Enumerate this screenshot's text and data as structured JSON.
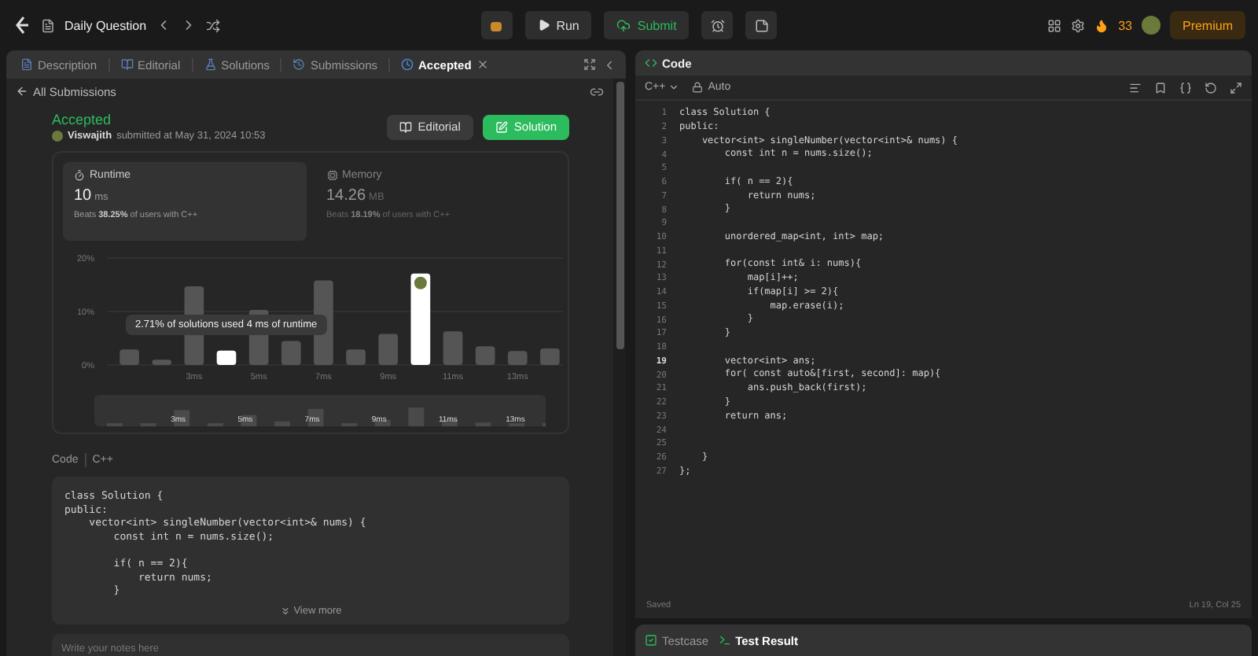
{
  "nav": {
    "title": "Daily Question",
    "run": "Run",
    "submit": "Submit",
    "streak": "33",
    "premium": "Premium"
  },
  "tabs": [
    {
      "label": "Description",
      "selected": false,
      "closable": false
    },
    {
      "label": "Editorial",
      "selected": false,
      "closable": false
    },
    {
      "label": "Solutions",
      "selected": false,
      "closable": false
    },
    {
      "label": "Submissions",
      "selected": false,
      "closable": false
    },
    {
      "label": "Accepted",
      "selected": true,
      "closable": true
    }
  ],
  "back_link": "All Submissions",
  "result": {
    "status": "Accepted",
    "user": "Viswajith",
    "submitted": "submitted at May 31, 2024 10:53",
    "editorial": "Editorial",
    "solution": "Solution"
  },
  "stats": [
    {
      "label": "Runtime",
      "value": "10",
      "unit": "ms",
      "beats": "Beats **38.25%** of users with C++",
      "selected": true
    },
    {
      "label": "Memory",
      "value": "14.26",
      "unit": "MB",
      "beats": "Beats **18.19%** of users with C++",
      "selected": false
    }
  ],
  "chart_data": {
    "type": "bar",
    "stacked": true,
    "categories": [
      null,
      null,
      "3ms",
      null,
      "5ms",
      null,
      "7ms",
      null,
      "9ms",
      null,
      "11ms",
      null,
      "13ms",
      null
    ],
    "series": [
      {
        "color": "#555555",
        "values": [
          2.9,
          1.0,
          14.7,
          null,
          10.3,
          4.5,
          15.8,
          2.9,
          5.8,
          null,
          6.3,
          3.5,
          2.6,
          3.1
        ]
      },
      {
        "color": "#ffffff",
        "values": [
          null,
          null,
          null,
          2.7,
          null,
          null,
          null,
          null,
          null,
          17.1,
          null,
          null,
          null,
          null
        ]
      }
    ],
    "ylim": [
      0,
      20
    ],
    "yticks": [
      {
        "value": 0,
        "label": "0%"
      },
      {
        "value": 10,
        "label": "10%"
      },
      {
        "value": 20,
        "label": "20%"
      }
    ],
    "annotations": [
      {
        "text": "2.71% of solutions used 4 ms of runtime"
      }
    ]
  },
  "overview_labels": [
    "3ms",
    "5ms",
    "7ms",
    "9ms",
    "11ms",
    "13ms"
  ],
  "code_label": "Code",
  "code_lang": "C++",
  "snippet": "class Solution {\npublic:\n    vector<int> singleNumber(vector<int>& nums) {\n        const int n = nums.size();\n\n        if( n == 2){\n            return nums;\n        }",
  "view_more": "View more",
  "notes": {
    "placeholder": "Write your notes here"
  },
  "editor": {
    "title": "Code",
    "language": "C++",
    "mode": "Auto",
    "lines": [
      {
        "number": "1",
        "text": "class Solution {",
        "current": false
      },
      {
        "number": "2",
        "text": "public:",
        "current": false
      },
      {
        "number": "3",
        "text": "    vector<int> singleNumber(vector<int>& nums) {",
        "current": false
      },
      {
        "number": "4",
        "text": "        const int n = nums.size();",
        "current": false
      },
      {
        "number": "5",
        "current": false
      },
      {
        "number": "6",
        "text": "        if( n == 2){",
        "current": false
      },
      {
        "number": "7",
        "text": "            return nums;",
        "current": false
      },
      {
        "number": "8",
        "text": "        }",
        "current": false
      },
      {
        "number": "9",
        "current": false
      },
      {
        "number": "10",
        "text": "        unordered_map<int, int> map;",
        "current": false
      },
      {
        "number": "11",
        "current": false
      },
      {
        "number": "12",
        "text": "        for(const int& i: nums){",
        "current": false
      },
      {
        "number": "13",
        "text": "            map[i]++;",
        "current": false
      },
      {
        "number": "14",
        "text": "            if(map[i] >= 2){",
        "current": false
      },
      {
        "number": "15",
        "text": "                map.erase(i);",
        "current": false
      },
      {
        "number": "16",
        "text": "            }",
        "current": false
      },
      {
        "number": "17",
        "text": "        }",
        "current": false
      },
      {
        "number": "18",
        "current": false
      },
      {
        "number": "19",
        "text": "        vector<int> ans;",
        "current": true
      },
      {
        "number": "20",
        "text": "        for( const auto&[first, second]: map){",
        "current": false
      },
      {
        "number": "21",
        "text": "            ans.push_back(first);",
        "current": false
      },
      {
        "number": "22",
        "text": "        }",
        "current": false
      },
      {
        "number": "23",
        "text": "        return ans;",
        "current": false
      },
      {
        "number": "24",
        "current": false
      },
      {
        "number": "25",
        "current": false
      },
      {
        "number": "26",
        "text": "    }",
        "current": false
      },
      {
        "number": "27",
        "text": "};",
        "current": false
      }
    ],
    "saved": "Saved",
    "position": "Ln 19, Col 25"
  },
  "bottom_tabs": [
    {
      "label": "Testcase",
      "selected": false
    },
    {
      "label": "Test Result",
      "selected": true
    }
  ]
}
